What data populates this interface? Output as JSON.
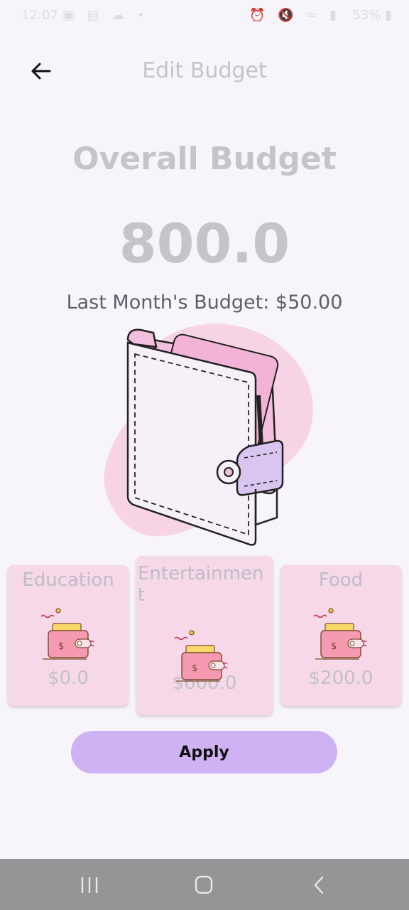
{
  "status_bar": {
    "time": "12:07",
    "battery": "53%",
    "left_icons": [
      "gallery-icon",
      "news-icon",
      "cloud-icon",
      "dot-icon"
    ],
    "right_icons": [
      "alarm-icon",
      "mute-icon",
      "wifi-icon",
      "signal-icon"
    ]
  },
  "header": {
    "title": "Edit Budget"
  },
  "overall": {
    "title": "Overall Budget",
    "amount": "800.0",
    "last_month": "Last Month's Budget: $50.00"
  },
  "categories": [
    {
      "label": "Education",
      "amount": "$0.0"
    },
    {
      "label": "Entertainmen\nt",
      "amount": "$600.0"
    },
    {
      "label": "Food",
      "amount": "$200.0"
    }
  ],
  "actions": {
    "apply_label": "Apply"
  },
  "colors": {
    "background": "#f8f4fb",
    "card": "#f6d8e9",
    "accent": "#cfb2f3",
    "muted_text": "#c6c3cb",
    "nav_bar": "#959598"
  }
}
